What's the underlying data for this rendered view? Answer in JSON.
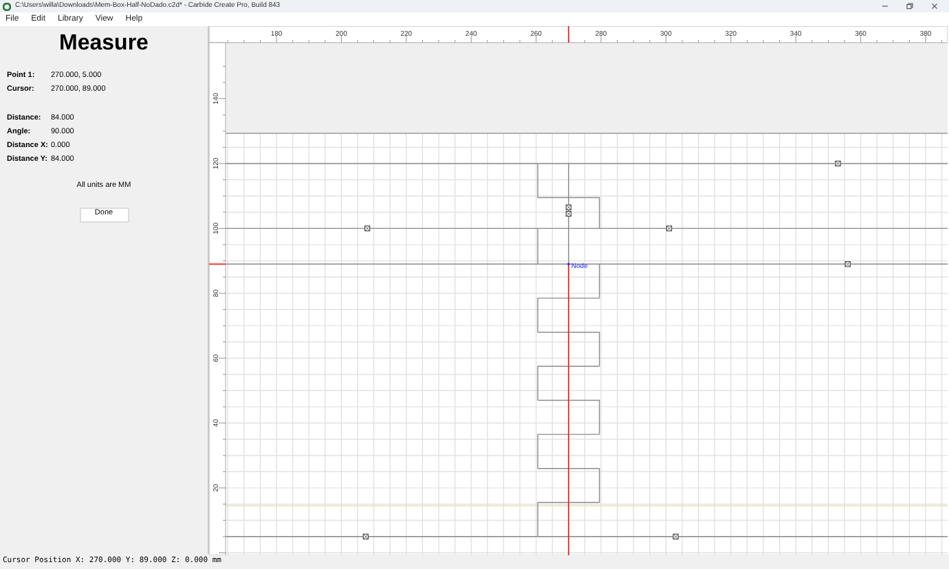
{
  "window": {
    "title": "C:\\Users\\willa\\Downloads\\Mem-Box-Half-NoDado.c2d* - Carbide Create Pro, Build 843"
  },
  "menu": [
    "File",
    "Edit",
    "Library",
    "View",
    "Help"
  ],
  "measure_panel": {
    "heading": "Measure",
    "fields": [
      {
        "label": "Point 1:",
        "value": "270.000, 5.000"
      },
      {
        "label": "Cursor:",
        "value": "270.000, 89.000"
      }
    ],
    "results": [
      {
        "label": "Distance:",
        "value": "84.000"
      },
      {
        "label": "Angle:",
        "value": "90.000"
      },
      {
        "label": "Distance X:",
        "value": "0.000"
      },
      {
        "label": "Distance Y:",
        "value": "84.000"
      }
    ],
    "note": "All units are MM",
    "button": "Done"
  },
  "canvas": {
    "top_ruler": [
      "180",
      "200",
      "220",
      "240",
      "260",
      "280",
      "300",
      "320",
      "340",
      "360",
      "380"
    ],
    "left_ruler": [
      "140",
      "120",
      "100",
      "80",
      "60",
      "40",
      "20"
    ],
    "node_label": "Node"
  },
  "status_bar": "Cursor Position X: 270.000 Y: 89.000 Z: 0.000 mm"
}
